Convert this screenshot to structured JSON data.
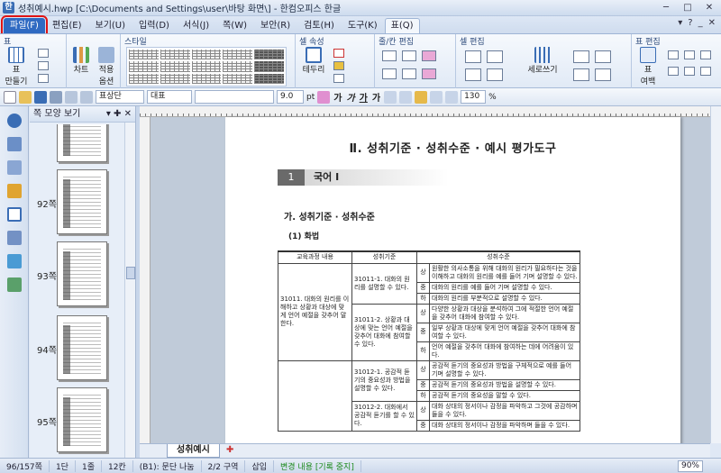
{
  "window": {
    "title": "성취예시.hwp [C:\\Documents and Settings\\user\\바탕 화면\\] - 한컴오피스 한글",
    "controls": [
      "─",
      "□",
      "✕"
    ]
  },
  "menu": {
    "tabs": [
      "파일(F)",
      "편집(E)",
      "보기(U)",
      "입력(D)",
      "서식(J)",
      "쪽(W)",
      "보안(R)",
      "검토(H)",
      "도구(K)",
      "표(Q)"
    ],
    "right": [
      "▾",
      "?",
      "_",
      "✕"
    ]
  },
  "ribbon": {
    "groups": [
      "표",
      "스타일",
      "셀 속성",
      "줄/칸 편집",
      "셀 편집",
      "표 편집"
    ],
    "buttons": {
      "table_make": "표\n만들기",
      "chart": "차트",
      "apply_options": "적용\n옵션",
      "border": "테두리",
      "vertical_write": "세로쓰기",
      "table_props": "표\n여백"
    }
  },
  "toolbar": {
    "style_name": "표상단",
    "font_lang": "대표",
    "font_name": "",
    "font_size": "9.0",
    "size_unit": "pt",
    "format_chars": [
      "가",
      "가",
      "가",
      "가"
    ],
    "zoom_field": "130",
    "zoom_unit": "%"
  },
  "panel": {
    "title": "쪽 모양 보기",
    "pages": [
      "92쪽",
      "93쪽",
      "94쪽",
      "95쪽"
    ]
  },
  "document": {
    "tab_name": "성취예시",
    "heading": "Ⅱ. 성취기준 · 성취수준 · 예시 평가도구",
    "section_number": "1",
    "section_title": "국어 Ⅰ",
    "subheading": "가. 성취기준 · 성취수준",
    "sub_subheading": "(1) 화법",
    "table": {
      "headers": [
        "교육과정 내용",
        "성취기준",
        "성취수준"
      ],
      "rows": [
        {
          "content": "31011. 대화의 원리를 이해하고 상황과 대상에 맞게 언어 예절을 갖추어 말한다.",
          "standard": "31011-1. 대화의 원리를 설명할 수 있다.",
          "levels": [
            [
              "상",
              "원활한 의사소통을 위해 대화의 원리가 필요하다는 것을 이해하고 대화의 원리를 예를 들어 기며 설명할 수 있다."
            ],
            [
              "중",
              "대화의 원리를 예를 들어 기며 설명할 수 있다."
            ],
            [
              "하",
              "대화의 원리를 부분적으로 설명할 수 있다."
            ]
          ]
        },
        {
          "content": "",
          "standard": "31011-2. 상황과 대상에 맞는 언어 예절을 갖추어 대화에 참여할 수 있다.",
          "levels": [
            [
              "상",
              "다양한 상황과 대상을 분석하여 그에 적절한 언어 예절을 갖추어 대화에 참여할 수 있다."
            ],
            [
              "중",
              "일부 상황과 대상에 맞게 언어 예절을 갖추어 대화에 참여할 수 있다."
            ],
            [
              "하",
              "언어 예절을 갖추어 대화에 참여하는 데에 어려움이 있다."
            ]
          ]
        },
        {
          "content": "",
          "standard": "31012-1. 공감적 듣기의 중요성과 방법을 설명할 수 있다.",
          "levels": [
            [
              "상",
              "공감적 듣기의 중요성과 방법을 구체적으로 예를 들어 기며 설명할 수 있다."
            ],
            [
              "중",
              "공감적 듣기의 중요성과 방법을 설명할 수 있다."
            ],
            [
              "하",
              "공감적 듣기의 중요성을 말할 수 있다."
            ]
          ]
        },
        {
          "content": "",
          "standard": "31012-2. 대화에서 공감적 듣기를 할 수 있다.",
          "levels": [
            [
              "상",
              "대화 상대의 정서이나 감정을 파악하고 그것에 공감하며 들을 수 있다."
            ],
            [
              "중",
              "대화 상대의 정서이나 감정을 파악하며 들을 수 있다."
            ]
          ]
        }
      ]
    }
  },
  "status": {
    "page_count": "96/157쪽",
    "section": "1단",
    "line": "1줄",
    "col": "12칸",
    "cell": "(B1): 문단 나눔",
    "region": "2/2 구역",
    "mode": "삽입",
    "track": "변경 내용 [기록 중지]",
    "zoom": "90%"
  },
  "colors": {
    "file_tab": "#2f6ac2",
    "highlight_box": "#e01414",
    "status_green": "#1d8a1d"
  }
}
